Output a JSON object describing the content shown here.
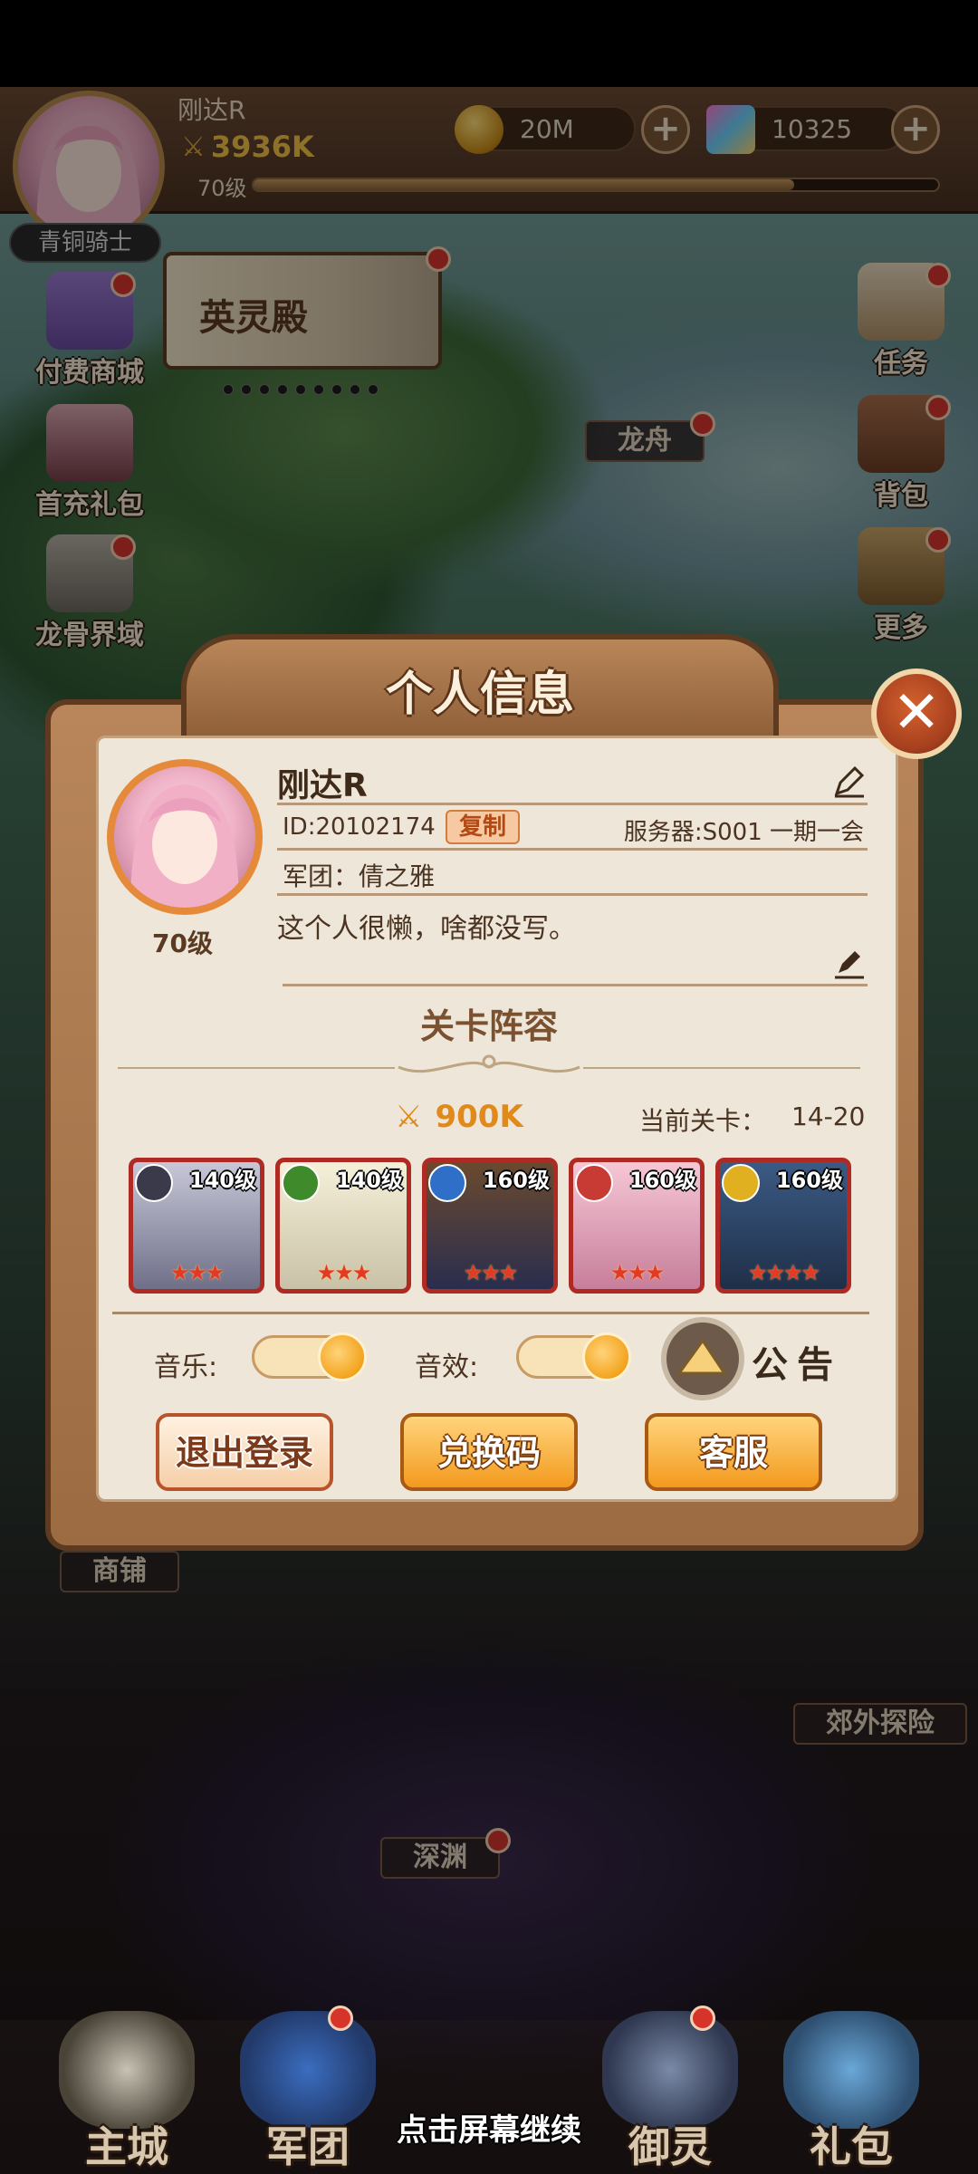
{
  "hud": {
    "player_name": "刚达R",
    "power": "3936K",
    "level": "70级",
    "xp_fraction": 0.79,
    "gold": "20M",
    "gems": "10325",
    "title_badge": "青铜骑士"
  },
  "side_left": [
    {
      "label": "付费商城"
    },
    {
      "label": "首充礼包"
    },
    {
      "label": "龙骨界域"
    }
  ],
  "side_right": [
    {
      "label": "任务"
    },
    {
      "label": "背包"
    },
    {
      "label": "更多"
    }
  ],
  "banner": {
    "label": "英灵殿"
  },
  "map_tags": {
    "dragon_boat": "龙舟",
    "shop": "商铺",
    "explore": "郊外探险",
    "abyss": "深渊"
  },
  "modal": {
    "title": "个人信息",
    "name": "刚达R",
    "level": "70级",
    "id": "ID:20102174",
    "copy": "复制",
    "server": "服务器:S001 一期一会",
    "guild": "军团：倩之雅",
    "signature": "这个人很懒，啥都没写。",
    "lineup_title": "关卡阵容",
    "lineup_power": "900K",
    "stage_label": "当前关卡：",
    "stage_value": "14-20",
    "heroes": [
      {
        "level": "140级",
        "element_color": "#3a3a4a",
        "stars": "★★★"
      },
      {
        "level": "140级",
        "element_color": "#3f8a2a",
        "stars": "★★★"
      },
      {
        "level": "160级",
        "element_color": "#2f6fc7",
        "stars": "★★★"
      },
      {
        "level": "160级",
        "element_color": "#c83a34",
        "stars": "★★★"
      },
      {
        "level": "160级",
        "element_color": "#e0b020",
        "stars": "★★★★"
      }
    ],
    "music_label": "音乐:",
    "sfx_label": "音效:",
    "notice_label": "公告",
    "logout": "退出登录",
    "redeem": "兑换码",
    "service": "客服"
  },
  "bottom_nav": [
    {
      "label": "主城"
    },
    {
      "label": "军团"
    },
    {
      "label": "御灵"
    },
    {
      "label": "礼包"
    }
  ],
  "continue_hint": "点击屏幕继续",
  "colors": {
    "accent_orange": "#f39a1e",
    "frame_brown": "#9c6b42",
    "panel_bg": "#efe6da",
    "red_dot": "#d6342b"
  }
}
